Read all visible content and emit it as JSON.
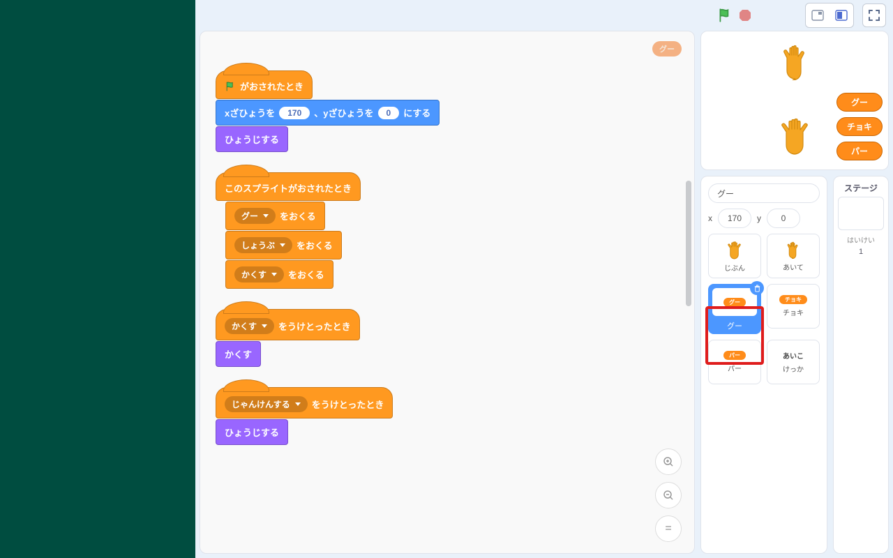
{
  "header": {
    "flag": "flag",
    "stop": "stop"
  },
  "watermark_pill": "グー",
  "scripts": {
    "s1": {
      "hat": "がおされたとき",
      "goto_pre": "xざひょうを",
      "goto_x": "170",
      "goto_mid": "、yざひょうを",
      "goto_y": "0",
      "goto_post": "にする",
      "show": "ひょうじする"
    },
    "s2": {
      "hat": "このスプライトがおされたとき",
      "b1_drop": "グー",
      "b1_tail": "をおくる",
      "b2_drop": "しょうぶ",
      "b2_tail": "をおくる",
      "b3_drop": "かくす",
      "b3_tail": "をおくる"
    },
    "s3": {
      "hat_drop": "かくす",
      "hat_tail": "をうけとったとき",
      "hide": "かくす"
    },
    "s4": {
      "hat_drop": "じゃんけんする",
      "hat_tail": "をうけとったとき",
      "show": "ひょうじする"
    }
  },
  "stage": {
    "btns": {
      "gu": "グー",
      "choki": "チョキ",
      "pa": "パー"
    }
  },
  "sprite_info": {
    "name": "グー",
    "x_label": "x",
    "x": "170",
    "y_label": "y",
    "y": "0"
  },
  "sprites": {
    "jibun": "じぶん",
    "aite": "あいて",
    "gu": "グー",
    "gu_pill": "グー",
    "choki": "チョキ",
    "choki_pill": "チョキ",
    "pa": "パー",
    "pa_pill": "パー",
    "aiko": "あいこ",
    "kekka": "けっか"
  },
  "stage_pane": {
    "title": "ステージ",
    "backdrops": "はいけい",
    "count": "1"
  }
}
